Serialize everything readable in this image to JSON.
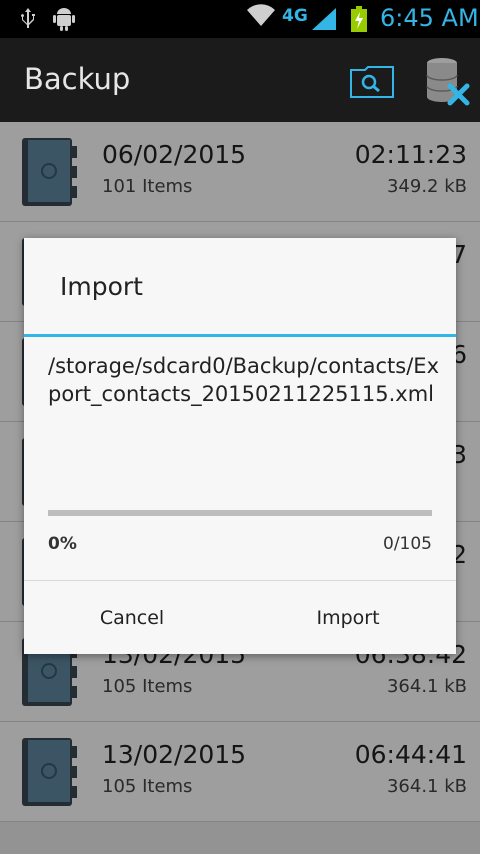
{
  "status_bar": {
    "network_type": "4G",
    "time": "6:45 AM",
    "icons": [
      "usb-icon",
      "android-debug-icon",
      "wifi-icon",
      "signal-icon",
      "battery-charging-icon"
    ],
    "accent_color": "#33b5e5"
  },
  "action_bar": {
    "title": "Backup",
    "icons": [
      "search-folder-icon",
      "database-delete-icon"
    ]
  },
  "backups": [
    {
      "date": "06/02/2015",
      "items": "101 Items",
      "time": "02:11:23",
      "size": "349.2 kB"
    },
    {
      "date": "",
      "items": "",
      "time": "7",
      "size": ""
    },
    {
      "date": "",
      "items": "",
      "time": "6",
      "size": ""
    },
    {
      "date": "",
      "items": "",
      "time": "3",
      "size": ""
    },
    {
      "date": "",
      "items": "",
      "time": "2",
      "size": ""
    },
    {
      "date": "13/02/2015",
      "items": "105 Items",
      "time": "06:38:42",
      "size": "364.1 kB"
    },
    {
      "date": "13/02/2015",
      "items": "105 Items",
      "time": "06:44:41",
      "size": "364.1 kB"
    }
  ],
  "dialog": {
    "title": "Import",
    "path": "/storage/sdcard0/Backup/contacts/Export_contacts_20150211225115.xml",
    "progress_fraction": 0,
    "percent_label": "0%",
    "count_label": "0/105",
    "cancel_label": "Cancel",
    "import_label": "Import"
  }
}
